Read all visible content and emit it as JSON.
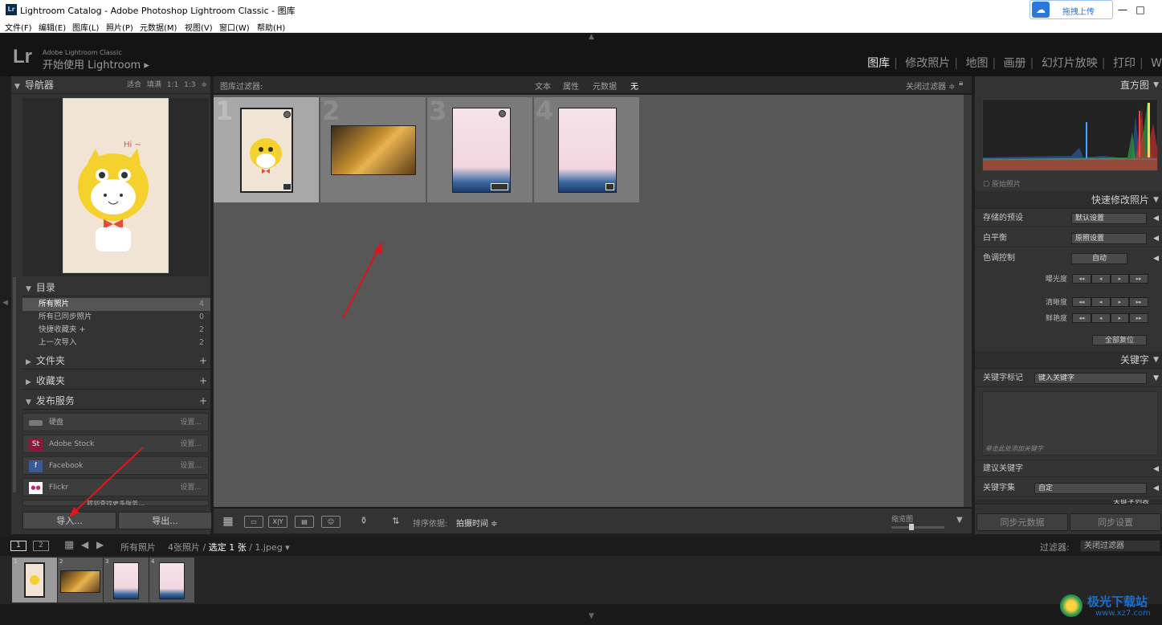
{
  "window": {
    "app_icon": "Lr",
    "title": "Lightroom Catalog - Adobe Photoshop Lightroom Classic - 图库",
    "cloud_button": "拖拽上传",
    "minimize": "—",
    "maximize": "□"
  },
  "menu": [
    "文件(F)",
    "编辑(E)",
    "图库(L)",
    "照片(P)",
    "元数据(M)",
    "视图(V)",
    "窗口(W)",
    "帮助(H)"
  ],
  "identity": {
    "logo": "Lr",
    "product": "Adobe Lightroom Classic",
    "start": "开始使用 Lightroom  ▸"
  },
  "modules": [
    "图库",
    "修改照片",
    "地图",
    "画册",
    "幻灯片放映",
    "打印",
    "W"
  ],
  "active_module": "图库",
  "left": {
    "navigator": {
      "title": "导航器",
      "options": "适合 填满 1:1 1:3 ≑"
    },
    "catalog": {
      "title": "目录",
      "items": [
        {
          "label": "所有照片",
          "count": "4"
        },
        {
          "label": "所有已同步照片",
          "count": "0"
        },
        {
          "label": "快捷收藏夹 +",
          "count": "2"
        },
        {
          "label": "上一次导入",
          "count": "2"
        }
      ]
    },
    "folders": "文件夹",
    "collections": "收藏夹",
    "publish": {
      "title": "发布服务",
      "services": [
        {
          "name": "硬盘",
          "settings": "设置...",
          "icon": "hard-drive-icon"
        },
        {
          "name": "Adobe Stock",
          "settings": "设置...",
          "icon": "adobe-stock-icon",
          "badge": "St"
        },
        {
          "name": "Facebook",
          "settings": "设置...",
          "icon": "facebook-icon",
          "badge": "f"
        },
        {
          "name": "Flickr",
          "settings": "设置...",
          "icon": "flickr-icon",
          "badge": "●●"
        }
      ],
      "more": "转到查找更多服务..."
    },
    "import_button": "导入...",
    "export_button": "导出..."
  },
  "filter": {
    "label": "图库过滤器:",
    "options": [
      "文本",
      "属性",
      "元数据",
      "无"
    ],
    "close": "关闭过滤器 ≑"
  },
  "grid": {
    "cells": [
      {
        "index": "1"
      },
      {
        "index": "2"
      },
      {
        "index": "3"
      },
      {
        "index": "4"
      }
    ],
    "nav_image_caption": "Hi ~"
  },
  "toolbar": {
    "sort_label": "排序依据:",
    "sort_value": "拍摄时间 ≑",
    "thumb_label": "缩览图",
    "xy": "X|Y"
  },
  "right": {
    "histogram": {
      "title": "直方图",
      "original": "原始照片"
    },
    "quick_develop": {
      "title": "快速修改照片",
      "saved_preset": {
        "label": "存储的预设",
        "value": "默认设置"
      },
      "white_balance": {
        "label": "白平衡",
        "value": "原照设置"
      },
      "tone": {
        "label": "色调控制",
        "value": "自动"
      },
      "exposure": "曝光度",
      "clarity": "清晰度",
      "vibrance": "鲜艳度",
      "reset": "全部复位"
    },
    "keywords": {
      "title": "关键字",
      "tags_label": "关键字标记",
      "tags_value": "键入关键字",
      "placeholder": "单击此处添加关键字",
      "suggested": "建议关键字",
      "set_label": "关键字集",
      "set_value": "自定",
      "list": "关键字列表"
    },
    "sync_meta": "同步元数据",
    "sync_settings": "同步设置"
  },
  "filmstrip": {
    "page1": "1",
    "page2": "2",
    "source": "所有照片",
    "info_a": "4张照片 / ",
    "info_sel": "选定 1 张",
    "info_b": " / 1.jpeg ▾",
    "filter_label": "过滤器:",
    "filter_value": "关闭过滤器",
    "cells": [
      "1",
      "2",
      "3",
      "4"
    ]
  },
  "watermark": {
    "name": "极光下载站",
    "url": "www.xz7.com"
  },
  "colors": {
    "accent_arrow": "#e0141a",
    "selected_cell": "#a8a8a8"
  }
}
